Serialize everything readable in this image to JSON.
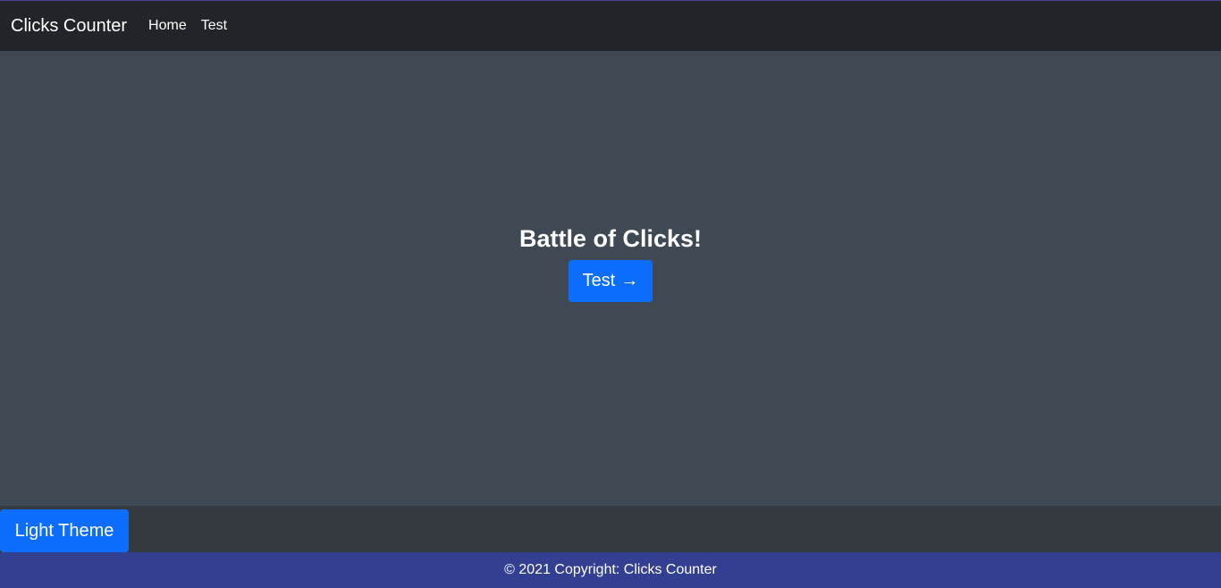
{
  "navbar": {
    "brand": "Clicks Counter",
    "links": [
      {
        "label": "Home"
      },
      {
        "label": "Test"
      }
    ]
  },
  "hero": {
    "title": "Battle of Clicks!",
    "button_label": "Test",
    "button_icon": "→"
  },
  "theme_toggle": {
    "label": "Light Theme"
  },
  "footer": {
    "text": "© 2021 Copyright: Clicks Counter"
  },
  "colors": {
    "navbar_bg": "#212529",
    "main_bg": "#3f4954",
    "theme_bar_bg": "#343a40",
    "footer_bg": "#333f91",
    "primary": "#0d6efd"
  }
}
